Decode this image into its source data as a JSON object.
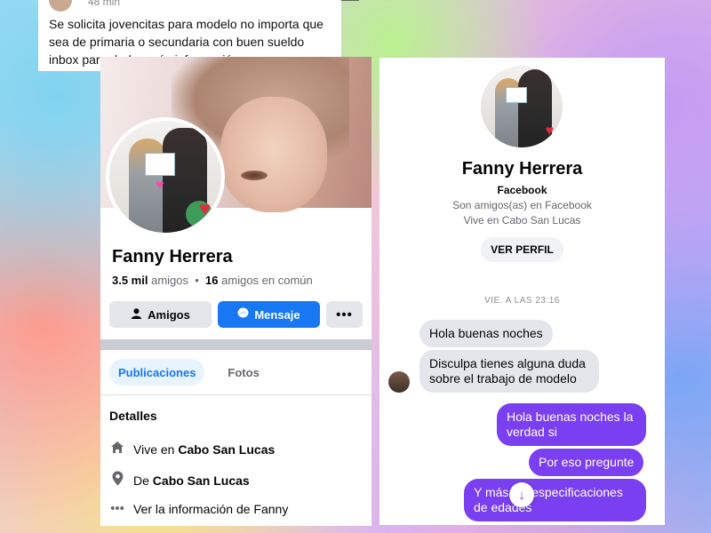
{
  "post": {
    "time": "48 min",
    "text": "Se solicita jovencitas para modelo no importa que sea de primaria o secundaria con buen sueldo inbox para darles más información"
  },
  "profile": {
    "name": "Fanny Herrera",
    "friends_count": "3.5 mil",
    "friends_label": "amigos",
    "separator": "•",
    "mutual_count": "16",
    "mutual_label": "amigos en común",
    "buttons": {
      "friends": "Amigos",
      "message": "Mensaje",
      "more": "•••"
    },
    "tabs": [
      "Publicaciones",
      "Fotos"
    ],
    "details_title": "Detalles",
    "details": [
      {
        "icon": "home-icon",
        "prefix": "Vive en",
        "value": "Cabo San Lucas"
      },
      {
        "icon": "location-pin-icon",
        "prefix": "De",
        "value": "Cabo San Lucas"
      },
      {
        "icon": "more-dots-icon",
        "prefix": "Ver la información de Fanny",
        "value": ""
      }
    ],
    "accent_color": "#1877f2"
  },
  "messenger": {
    "name": "Fanny Herrera",
    "platform": "Facebook",
    "friends_note": "Son amigos(as) en Facebook",
    "lives_note": "Vive en Cabo San Lucas",
    "view_profile": "VER PERFIL",
    "timestamp": "VIE. A LAS 23:16",
    "incoming": [
      "Hola buenas noches",
      "Disculpa tienes alguna duda sobre el trabajo de modelo"
    ],
    "outgoing": [
      "Hola buenas noches la verdad si",
      "Por eso pregunte",
      "Y más las especificaciones de edades"
    ],
    "outgoing_color": "#7a3ff0"
  }
}
